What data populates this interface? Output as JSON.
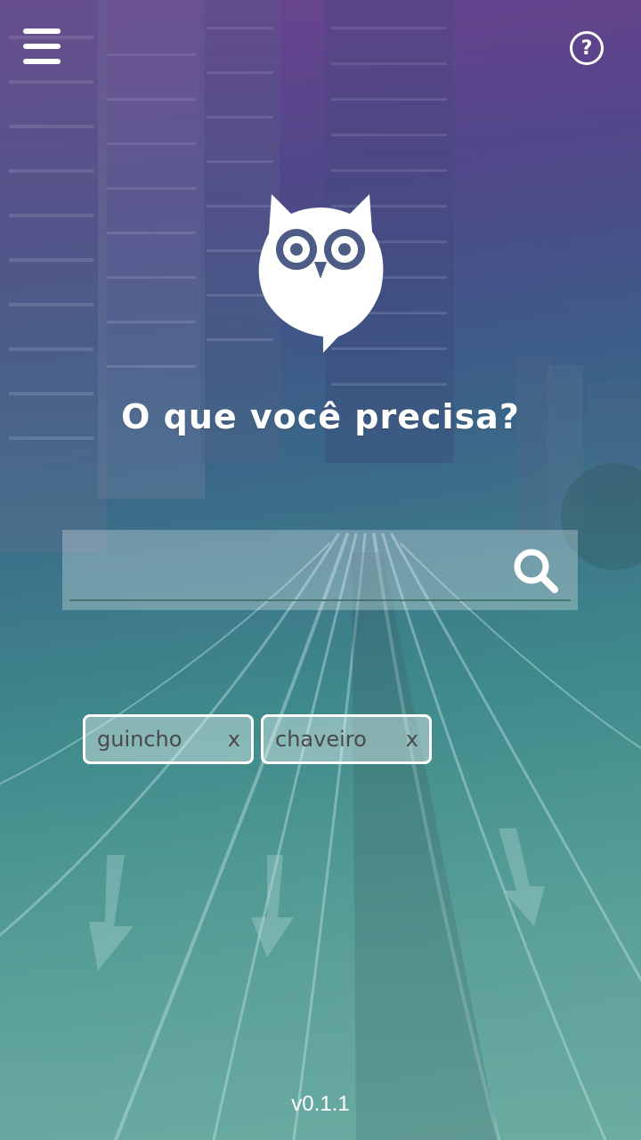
{
  "header": {
    "menu_icon": "hamburger-menu-icon",
    "help_icon": "question-circle-icon",
    "help_glyph": "?"
  },
  "logo": {
    "icon": "owl-logo-icon"
  },
  "headline": "O que você precisa?",
  "search": {
    "placeholder": "",
    "value": "",
    "icon": "search-icon"
  },
  "tags": [
    {
      "label": "guincho",
      "remove": "x"
    },
    {
      "label": "chaveiro",
      "remove": "x"
    }
  ],
  "version": "v0.1.1",
  "colors": {
    "top_gradient": "#6a4a92",
    "bottom_gradient": "#6aa89e",
    "text": "#ffffff",
    "chip_text": "#4a4a4a"
  }
}
